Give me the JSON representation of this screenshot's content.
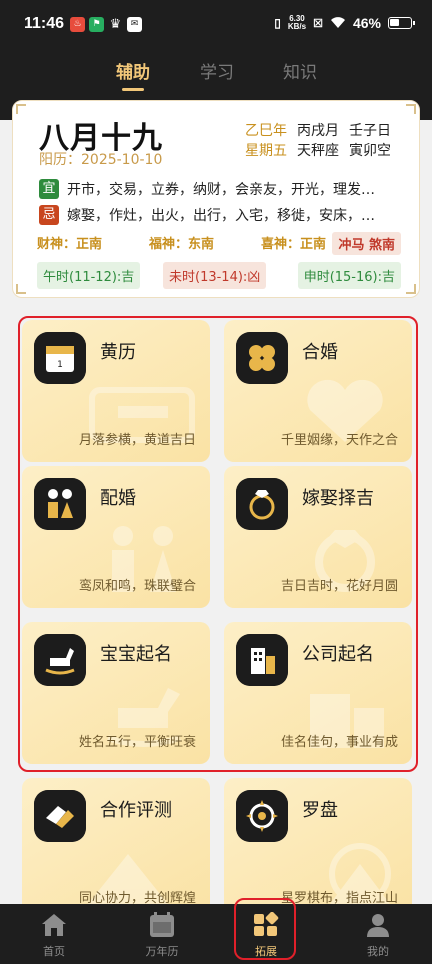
{
  "status_bar": {
    "time": "11:46",
    "net_speed_value": "6.30",
    "net_speed_unit": "KB/s",
    "battery": "46%"
  },
  "top_tabs": [
    {
      "label": "辅助",
      "active": true
    },
    {
      "label": "学习",
      "active": false
    },
    {
      "label": "知识",
      "active": false
    }
  ],
  "almanac": {
    "lunar_date": "八月十九",
    "solar_date": "阳历：2025-10-10",
    "year_gz": "乙巳年",
    "month_gz": "丙戌月",
    "day_gz": "壬子日",
    "weekday": "星期五",
    "zodiac": "天秤座",
    "kong": "寅卯空",
    "yi_label": "宜",
    "yi": "开市，交易，立券，纳财，会亲友，开光，理发…",
    "ji_label": "忌",
    "ji": "嫁娶，作灶，出火，出行，入宅，移徙，安床，…",
    "wealth_god": "财神：正南",
    "fortune_god": "福神：东南",
    "joy_god": "喜神：正南",
    "clash": "冲马 煞南",
    "hours": [
      {
        "text": "午时(11-12):吉",
        "good": true
      },
      {
        "text": "未时(13-14):凶",
        "good": false
      },
      {
        "text": "申时(15-16):吉",
        "good": true
      }
    ]
  },
  "features": [
    {
      "title": "黄历",
      "subtitle": "月落参横，黄道吉日",
      "icon": "calendar-icon"
    },
    {
      "title": "合婚",
      "subtitle": "千里姻缘，天作之合",
      "icon": "clover-heart-icon"
    },
    {
      "title": "配婚",
      "subtitle": "鸾凤和鸣，珠联璧合",
      "icon": "couple-icon"
    },
    {
      "title": "嫁娶择吉",
      "subtitle": "吉日吉时，花好月圆",
      "icon": "ring-icon"
    },
    {
      "title": "宝宝起名",
      "subtitle": "姓名五行，平衡旺衰",
      "icon": "rocking-horse-icon"
    },
    {
      "title": "公司起名",
      "subtitle": "佳名佳句，事业有成",
      "icon": "building-icon"
    },
    {
      "title": "合作评测",
      "subtitle": "同心协力，共创辉煌",
      "icon": "handshake-icon"
    },
    {
      "title": "罗盘",
      "subtitle": "星罗棋布，指点江山",
      "icon": "compass-icon"
    }
  ],
  "bottom_nav": [
    {
      "label": "首页",
      "icon": "home-icon",
      "active": false
    },
    {
      "label": "万年历",
      "icon": "calendar-book-icon",
      "active": false
    },
    {
      "label": "拓展",
      "icon": "grid-apps-icon",
      "active": true
    },
    {
      "label": "我的",
      "icon": "user-icon",
      "active": false
    }
  ],
  "colors": {
    "accent_gold": "#f2c779",
    "dark_bg": "#1e1e1e",
    "highlight_red": "#e0202a"
  }
}
